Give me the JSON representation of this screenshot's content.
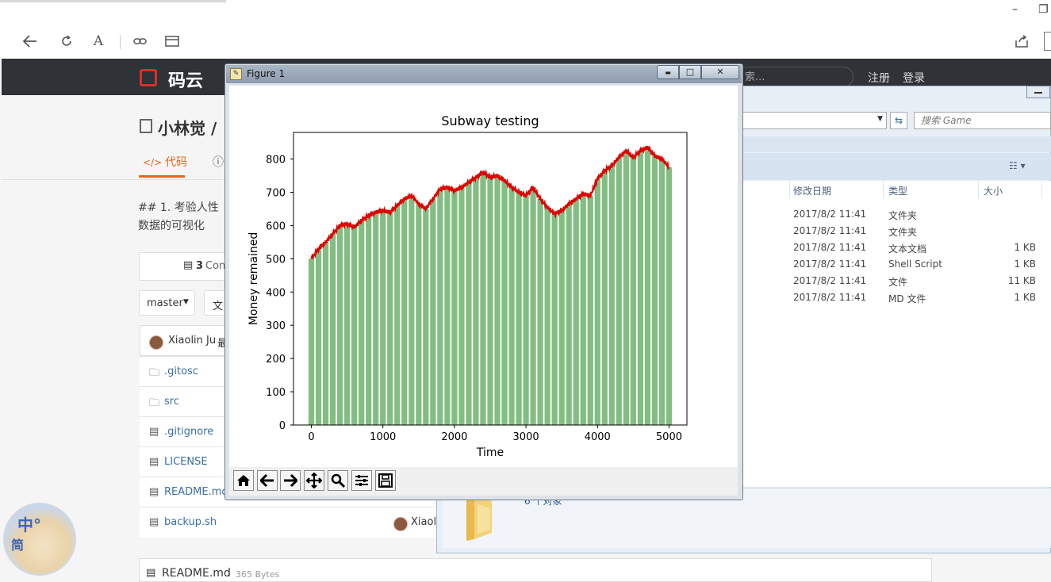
{
  "browser": {
    "window_controls": {
      "minimize": "–",
      "restore": "❐"
    }
  },
  "gitee": {
    "brand": "码云",
    "search_placeholder": "索...",
    "register": "注册",
    "login": "登录",
    "repo_title": "小林觉 / ",
    "tab_code": "代码",
    "desc_line1": "## 1. 考验人性",
    "desc_line2": "数据的可视化",
    "commits_count": "3",
    "commits_label": "Con",
    "branch": "master",
    "btn_file": "文",
    "last_commit_author": "Xiaolin Ju",
    "last_commit_suffix": "最",
    "files": [
      {
        "name": ".gitosc",
        "icon": "folder-icon"
      },
      {
        "name": "src",
        "icon": "folder-icon"
      },
      {
        "name": ".gitignore",
        "icon": "file-icon"
      },
      {
        "name": "LICENSE",
        "icon": "file-icon"
      },
      {
        "name": "README.md",
        "icon": "file-icon"
      },
      {
        "name": "backup.sh",
        "icon": "file-icon"
      }
    ],
    "backup_author": "Xiaol",
    "readme_label": "README.md",
    "readme_size": "365 Bytes"
  },
  "explorer": {
    "search_placeholder": "搜索 Game",
    "columns": {
      "modified": "修改日期",
      "type": "类型",
      "size": "大小"
    },
    "rows": [
      {
        "modified": "2017/8/2 11:41",
        "type": "文件夹",
        "size": ""
      },
      {
        "modified": "2017/8/2 11:41",
        "type": "文件夹",
        "size": ""
      },
      {
        "modified": "2017/8/2 11:41",
        "type": "文本文档",
        "size": "1 KB"
      },
      {
        "modified": "2017/8/2 11:41",
        "type": "Shell Script",
        "size": "1 KB"
      },
      {
        "modified": "2017/8/2 11:41",
        "type": "文件",
        "size": "11 KB"
      },
      {
        "modified": "2017/8/2 11:41",
        "type": "MD 文件",
        "size": "1 KB"
      }
    ],
    "status": "6 个对象"
  },
  "figure": {
    "window_title": "Figure 1",
    "buttons": {
      "minimize": "▬",
      "maximize": "□",
      "close": "✕"
    }
  },
  "chart_data": {
    "type": "bar",
    "title": "Subway testing",
    "xlabel": "Time",
    "ylabel": "Money remained",
    "xlim": [
      -250,
      5250
    ],
    "ylim": [
      0,
      880
    ],
    "xticks": [
      0,
      1000,
      2000,
      3000,
      4000,
      5000
    ],
    "yticks": [
      0,
      100,
      200,
      300,
      400,
      500,
      600,
      700,
      800
    ],
    "bar_color": "#82bd82",
    "line_color": "#e00000",
    "series": [
      {
        "type": "line+bar",
        "x": [
          0,
          100,
          200,
          300,
          400,
          500,
          600,
          700,
          800,
          900,
          1000,
          1100,
          1200,
          1300,
          1400,
          1500,
          1600,
          1700,
          1800,
          1900,
          2000,
          2100,
          2200,
          2300,
          2400,
          2500,
          2600,
          2700,
          2800,
          2900,
          3000,
          3100,
          3200,
          3300,
          3400,
          3500,
          3600,
          3700,
          3800,
          3900,
          4000,
          4100,
          4200,
          4300,
          4400,
          4500,
          4600,
          4700,
          4800,
          4900,
          5000
        ],
        "values": [
          500,
          530,
          550,
          575,
          600,
          605,
          595,
          615,
          630,
          640,
          645,
          640,
          660,
          680,
          690,
          665,
          650,
          680,
          710,
          715,
          705,
          715,
          730,
          745,
          760,
          745,
          750,
          735,
          715,
          700,
          690,
          715,
          680,
          655,
          635,
          645,
          665,
          680,
          695,
          690,
          740,
          765,
          780,
          805,
          825,
          805,
          825,
          835,
          810,
          800,
          775
        ]
      }
    ]
  }
}
